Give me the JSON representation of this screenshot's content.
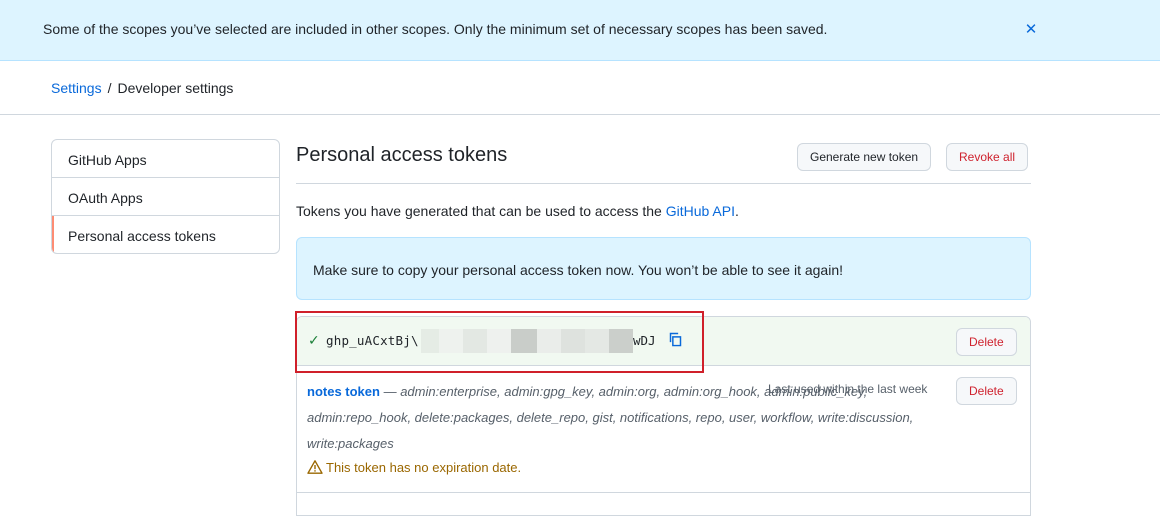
{
  "flash": {
    "message": "Some of the scopes you’ve selected are included in other scopes. Only the minimum set of necessary scopes has been saved.",
    "close_glyph": "✕"
  },
  "breadcrumb": {
    "settings": "Settings",
    "separator": "/",
    "current": "Developer settings"
  },
  "sidebar": {
    "items": [
      {
        "label": "GitHub Apps"
      },
      {
        "label": "OAuth Apps"
      },
      {
        "label": "Personal access tokens"
      }
    ]
  },
  "main": {
    "title": "Personal access tokens",
    "generate_label": "Generate new token",
    "revoke_label": "Revoke all",
    "intro_text": "Tokens you have generated that can be used to access the ",
    "intro_link": "GitHub API",
    "intro_end": ".",
    "notice": "Make sure to copy your personal access token now. You won’t be able to see it again!"
  },
  "new_token": {
    "prefix": "ghp_uACxtBj\\",
    "suffix": "wDJ",
    "delete_label": "Delete"
  },
  "token": {
    "name": "notes token",
    "scopes": " — admin:enterprise, admin:gpg_key, admin:org, admin:org_hook, admin:public_key, admin:repo_hook, delete:packages, delete_repo, gist, notifications, repo, user, workflow, write:discussion, write:packages",
    "last_used": "Last used within the last week",
    "delete_label": "Delete",
    "warning": "This token has no expiration date."
  },
  "colors": {
    "accent": "#0969da",
    "danger": "#cf222e",
    "success": "#1a7f37",
    "attention": "#9a6700",
    "highlight": "#d0202a"
  }
}
